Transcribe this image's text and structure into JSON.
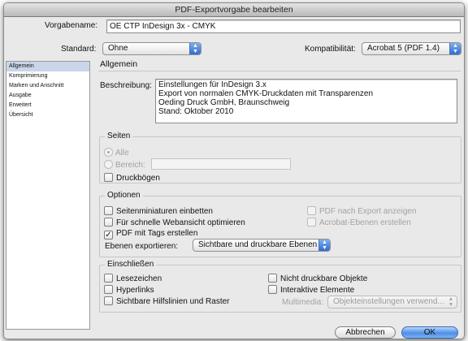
{
  "window": {
    "title": "PDF-Exportvorgabe bearbeiten"
  },
  "top": {
    "preset_label": "Vorgabename:",
    "preset_value": "OE CTP InDesign 3x - CMYK",
    "standard_label": "Standard:",
    "standard_value": "Ohne",
    "compat_label": "Kompatibilität:",
    "compat_value": "Acrobat 5 (PDF 1.4)"
  },
  "sidebar": {
    "items": [
      {
        "label": "Allgemein",
        "active": true
      },
      {
        "label": "Komprimierung"
      },
      {
        "label": "Marken und Anschnitt"
      },
      {
        "label": "Ausgabe"
      },
      {
        "label": "Erweitert"
      },
      {
        "label": "Übersicht"
      }
    ]
  },
  "main": {
    "section_title": "Allgemein",
    "description_label": "Beschreibung:",
    "description_lines": [
      "Einstellungen für InDesign 3.x",
      "Export von normalen CMYK-Druckdaten mit Transparenzen",
      "Oeding Druck GmbH, Braunschweig",
      "Stand: Oktober 2010"
    ],
    "pages": {
      "title": "Seiten",
      "all_label": "Alle",
      "range_label": "Bereich:",
      "range_value": "",
      "spreads_label": "Druckbögen"
    },
    "options": {
      "title": "Optionen",
      "embed_thumbnails": "Seitenminiaturen einbetten",
      "fast_web": "Für schnelle Webansicht optimieren",
      "tagged_pdf": "PDF mit Tags erstellen",
      "view_after_export": "PDF nach Export anzeigen",
      "acrobat_layers": "Acrobat-Ebenen erstellen",
      "export_layers_label": "Ebenen exportieren:",
      "export_layers_value": "Sichtbare und druckbare Ebenen",
      "tagged_checkmark": "✓"
    },
    "include": {
      "title": "Einschließen",
      "bookmarks": "Lesezeichen",
      "hyperlinks": "Hyperlinks",
      "guides_grids": "Sichtbare Hilfslinien und Raster",
      "non_printing": "Nicht druckbare Objekte",
      "interactive": "Interaktive Elemente",
      "multimedia_label": "Multimedia:",
      "multimedia_value": "Objekteinstellungen verwend..."
    }
  },
  "buttons": {
    "cancel": "Abbrechen",
    "ok": "OK"
  },
  "icons": {
    "popup_arrows": "updown-arrows-icon"
  },
  "colors": {
    "accent": "#3b78dc",
    "sidebar_selection": "#c9d5e8"
  }
}
